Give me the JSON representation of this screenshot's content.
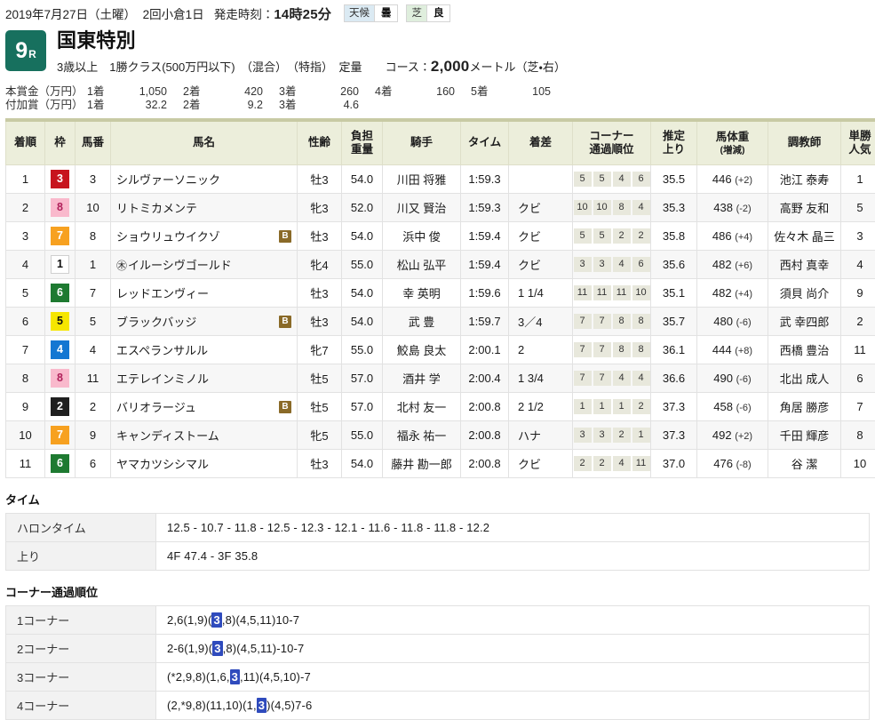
{
  "meta": {
    "date": "2019年7月27日（土曜）",
    "meeting": "2回小倉1日",
    "post_time_label": "発走時刻：",
    "post_time": "14時25分",
    "badges": [
      {
        "name": "weather",
        "label": "天候",
        "value": "曇"
      },
      {
        "name": "track",
        "label": "芝",
        "value": "良"
      }
    ]
  },
  "race": {
    "number": "9",
    "number_suffix": "R",
    "name": "国東特別",
    "conditions": "3歳以上　1勝クラス(500万円以下)　（混合）　（特指）　定量",
    "course_label": "コース：",
    "distance": "2,000",
    "distance_unit": "メートル",
    "course_detail": "（芝・右）",
    "accent_color": "#17705e"
  },
  "prizes": {
    "main": {
      "label": "本賞金（万円）",
      "entries": [
        {
          "pos": "1着",
          "amount": "1,050"
        },
        {
          "pos": "2着",
          "amount": "420"
        },
        {
          "pos": "3着",
          "amount": "260"
        },
        {
          "pos": "4着",
          "amount": "160"
        },
        {
          "pos": "5着",
          "amount": "105"
        }
      ]
    },
    "bonus": {
      "label": "付加賞（万円）",
      "entries": [
        {
          "pos": "1着",
          "amount": "32.2"
        },
        {
          "pos": "2着",
          "amount": "9.2"
        },
        {
          "pos": "3着",
          "amount": "4.6"
        }
      ]
    }
  },
  "result_table": {
    "headers": {
      "rank": "着順",
      "frame": "枠",
      "horse_number": "馬番",
      "horse_name": "馬名",
      "sex_age": "性齢",
      "weight_line1": "負担",
      "weight_line2": "重量",
      "jockey": "騎手",
      "time": "タイム",
      "margin": "着差",
      "corner_line1": "コーナー",
      "corner_line2": "通過順位",
      "last3f_line1": "推定",
      "last3f_line2": "上り",
      "horse_weight_line1": "馬体重",
      "horse_weight_line2": "(増減)",
      "trainer": "調教師",
      "popularity_line1": "単勝",
      "popularity_line2": "人気"
    },
    "rows": [
      {
        "rank": "1",
        "frame": "3",
        "horse_number": "3",
        "horse_name": "シルヴァーソニック",
        "mark": "",
        "blinker": "",
        "sex_age": "牡3",
        "weight": "54.0",
        "jockey": "川田 将雅",
        "time": "1:59.3",
        "margin": "",
        "corners": [
          "5",
          "5",
          "4",
          "6"
        ],
        "last3f": "35.5",
        "horse_weight": "446",
        "horse_weight_delta": "(+2)",
        "trainer": "池江 泰寿",
        "popularity": "1"
      },
      {
        "rank": "2",
        "frame": "8",
        "horse_number": "10",
        "horse_name": "リトミカメンテ",
        "mark": "",
        "blinker": "",
        "sex_age": "牝3",
        "weight": "52.0",
        "jockey": "川又 賢治",
        "time": "1:59.3",
        "margin": "クビ",
        "corners": [
          "10",
          "10",
          "8",
          "4"
        ],
        "last3f": "35.3",
        "horse_weight": "438",
        "horse_weight_delta": "(-2)",
        "trainer": "高野 友和",
        "popularity": "5"
      },
      {
        "rank": "3",
        "frame": "7",
        "horse_number": "8",
        "horse_name": "ショウリュウイクゾ",
        "mark": "",
        "blinker": "B",
        "sex_age": "牡3",
        "weight": "54.0",
        "jockey": "浜中 俊",
        "time": "1:59.4",
        "margin": "クビ",
        "corners": [
          "5",
          "5",
          "2",
          "2"
        ],
        "last3f": "35.8",
        "horse_weight": "486",
        "horse_weight_delta": "(+4)",
        "trainer": "佐々木 晶三",
        "popularity": "3"
      },
      {
        "rank": "4",
        "frame": "1",
        "horse_number": "1",
        "horse_name": "イルーシヴゴールド",
        "mark": "㊍",
        "blinker": "",
        "sex_age": "牝4",
        "weight": "55.0",
        "jockey": "松山 弘平",
        "time": "1:59.4",
        "margin": "クビ",
        "corners": [
          "3",
          "3",
          "4",
          "6"
        ],
        "last3f": "35.6",
        "horse_weight": "482",
        "horse_weight_delta": "(+6)",
        "trainer": "西村 真幸",
        "popularity": "4"
      },
      {
        "rank": "5",
        "frame": "6",
        "horse_number": "7",
        "horse_name": "レッドエンヴィー",
        "mark": "",
        "blinker": "",
        "sex_age": "牡3",
        "weight": "54.0",
        "jockey": "幸 英明",
        "time": "1:59.6",
        "margin": "1 1/4",
        "corners": [
          "11",
          "11",
          "11",
          "10"
        ],
        "last3f": "35.1",
        "horse_weight": "482",
        "horse_weight_delta": "(+4)",
        "trainer": "須貝 尚介",
        "popularity": "9"
      },
      {
        "rank": "6",
        "frame": "5",
        "horse_number": "5",
        "horse_name": "ブラックバッジ",
        "mark": "",
        "blinker": "B",
        "sex_age": "牡3",
        "weight": "54.0",
        "jockey": "武 豊",
        "time": "1:59.7",
        "margin": "3／4",
        "corners": [
          "7",
          "7",
          "8",
          "8"
        ],
        "last3f": "35.7",
        "horse_weight": "480",
        "horse_weight_delta": "(-6)",
        "trainer": "武 幸四郎",
        "popularity": "2"
      },
      {
        "rank": "7",
        "frame": "4",
        "horse_number": "4",
        "horse_name": "エスペランサルル",
        "mark": "",
        "blinker": "",
        "sex_age": "牝7",
        "weight": "55.0",
        "jockey": "鮫島 良太",
        "time": "2:00.1",
        "margin": "2",
        "corners": [
          "7",
          "7",
          "8",
          "8"
        ],
        "last3f": "36.1",
        "horse_weight": "444",
        "horse_weight_delta": "(+8)",
        "trainer": "西橋 豊治",
        "popularity": "11"
      },
      {
        "rank": "8",
        "frame": "8",
        "horse_number": "11",
        "horse_name": "エテレインミノル",
        "mark": "",
        "blinker": "",
        "sex_age": "牡5",
        "weight": "57.0",
        "jockey": "酒井 学",
        "time": "2:00.4",
        "margin": "1 3/4",
        "corners": [
          "7",
          "7",
          "4",
          "4"
        ],
        "last3f": "36.6",
        "horse_weight": "490",
        "horse_weight_delta": "(-6)",
        "trainer": "北出 成人",
        "popularity": "6"
      },
      {
        "rank": "9",
        "frame": "2",
        "horse_number": "2",
        "horse_name": "バリオラージュ",
        "mark": "",
        "blinker": "B",
        "sex_age": "牡5",
        "weight": "57.0",
        "jockey": "北村 友一",
        "time": "2:00.8",
        "margin": "2 1/2",
        "corners": [
          "1",
          "1",
          "1",
          "2"
        ],
        "last3f": "37.3",
        "horse_weight": "458",
        "horse_weight_delta": "(-6)",
        "trainer": "角居 勝彦",
        "popularity": "7"
      },
      {
        "rank": "10",
        "frame": "7",
        "horse_number": "9",
        "horse_name": "キャンディストーム",
        "mark": "",
        "blinker": "",
        "sex_age": "牝5",
        "weight": "55.0",
        "jockey": "福永 祐一",
        "time": "2:00.8",
        "margin": "ハナ",
        "corners": [
          "3",
          "3",
          "2",
          "1"
        ],
        "last3f": "37.3",
        "horse_weight": "492",
        "horse_weight_delta": "(+2)",
        "trainer": "千田 輝彦",
        "popularity": "8"
      },
      {
        "rank": "11",
        "frame": "6",
        "horse_number": "6",
        "horse_name": "ヤマカツシシマル",
        "mark": "",
        "blinker": "",
        "sex_age": "牡3",
        "weight": "54.0",
        "jockey": "藤井 勘一郎",
        "time": "2:00.8",
        "margin": "クビ",
        "corners": [
          "2",
          "2",
          "4",
          "11"
        ],
        "last3f": "37.0",
        "horse_weight": "476",
        "horse_weight_delta": "(-8)",
        "trainer": "谷 潔",
        "popularity": "10"
      }
    ]
  },
  "time_section": {
    "title": "タイム",
    "rows": [
      {
        "key": "ハロンタイム",
        "value": "12.5 - 10.7 - 11.8 - 12.5 - 12.3 - 12.1 - 11.6 - 11.8 - 11.8 - 12.2"
      },
      {
        "key": "上り",
        "value": "4F 47.4 - 3F 35.8"
      }
    ]
  },
  "corner_section": {
    "title": "コーナー通過順位",
    "highlight_color": "#2f4bbd",
    "rows": [
      {
        "key": "1コーナー",
        "pre": "2,6(1,9)(",
        "hl": "3",
        "post": ",8)(4,5,11)10-7"
      },
      {
        "key": "2コーナー",
        "pre": "2-6(1,9)(",
        "hl": "3",
        "post": ",8)(4,5,11)-10-7"
      },
      {
        "key": "3コーナー",
        "pre": "(*2,9,8)(1,6,",
        "hl": "3",
        "post": ",11)(4,5,10)-7"
      },
      {
        "key": "4コーナー",
        "pre": "(2,*9,8)(11,10)(1,",
        "hl": "3",
        "post": ")(4,5)7-6"
      }
    ]
  }
}
